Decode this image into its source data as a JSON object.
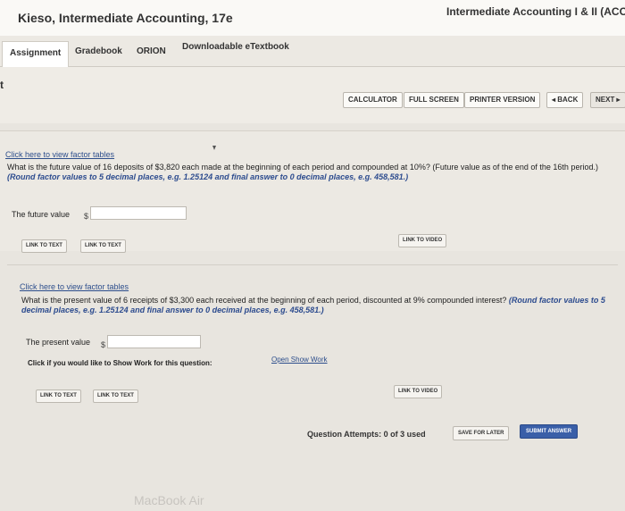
{
  "header": {
    "app_title": "Kieso, Intermediate Accounting, 17e",
    "course_title": "Intermediate Accounting I & II (ACC"
  },
  "tabs": [
    {
      "label": "Assignment",
      "active": true
    },
    {
      "label": "Gradebook"
    },
    {
      "label": "ORION"
    },
    {
      "label": "Downloadable eTextbook"
    }
  ],
  "left_stub": "t",
  "toolbar": {
    "calculator": "CALCULATOR",
    "full_screen": "FULL SCREEN",
    "printer_version": "PRINTER VERSION",
    "back": "◂ BACK",
    "next": "NEXT ▸"
  },
  "question1": {
    "factor_link": "Click here to view factor tables",
    "text": "What is the future value of 16 deposits of $3,820 each made at the beginning of each period and compounded at 10%? (Future value as of the end of the 16th period.) ",
    "hint": "(Round factor values to 5 decimal places, e.g. 1.25124 and final answer to 0 decimal places, e.g. 458,581.)",
    "answer_label": "The future value",
    "currency": "$",
    "answer_value": "",
    "link_text_1": "LINK TO TEXT",
    "link_text_2": "LINK TO TEXT",
    "link_video": "LINK TO VIDEO"
  },
  "question2": {
    "factor_link": "Click here to view factor tables",
    "text": "What is the present value of 6 receipts of $3,300 each received at the beginning of each period, discounted at 9% compounded interest? ",
    "hint": "(Round factor values to 5 decimal places, e.g. 1.25124 and final answer to 0 decimal places, e.g. 458,581.)",
    "answer_label": "The present value",
    "currency": "$",
    "answer_value": "",
    "show_work_prompt": "Click if you would like to Show Work for this question:",
    "show_work_link": "Open Show Work",
    "link_text_1": "LINK TO TEXT",
    "link_text_2": "LINK TO TEXT",
    "link_video": "LINK TO VIDEO"
  },
  "footer": {
    "attempts": "Question Attempts: 0 of 3 used",
    "save_later": "SAVE FOR LATER",
    "submit": "SUBMIT ANSWER"
  },
  "bezel_label": "MacBook Air"
}
